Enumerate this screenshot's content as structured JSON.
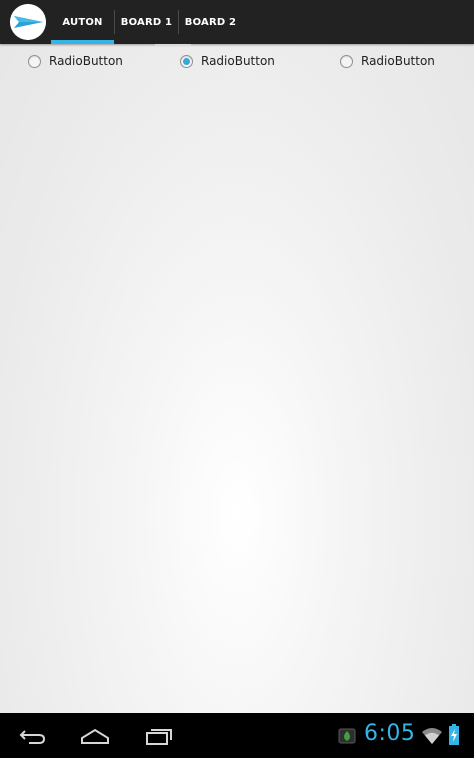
{
  "action_bar": {
    "app_icon": "paper-plane-icon",
    "tabs": [
      {
        "label": "AUTON",
        "selected": true
      },
      {
        "label": "BOARD 1",
        "selected": false
      },
      {
        "label": "BOARD 2",
        "selected": false
      }
    ]
  },
  "radio_group": {
    "options": [
      {
        "label": "RadioButton",
        "checked": false
      },
      {
        "label": "RadioButton",
        "checked": true
      },
      {
        "label": "RadioButton",
        "checked": false
      }
    ]
  },
  "nav_bar": {
    "buttons": [
      "back-icon",
      "home-icon",
      "recent-apps-icon"
    ]
  },
  "status_bar": {
    "time": "6:05",
    "icons": [
      "notification-icon",
      "wifi-icon",
      "battery-charging-icon"
    ]
  },
  "colors": {
    "accent": "#33b5e5",
    "action_bar": "#222222",
    "nav_bar": "#000000"
  }
}
